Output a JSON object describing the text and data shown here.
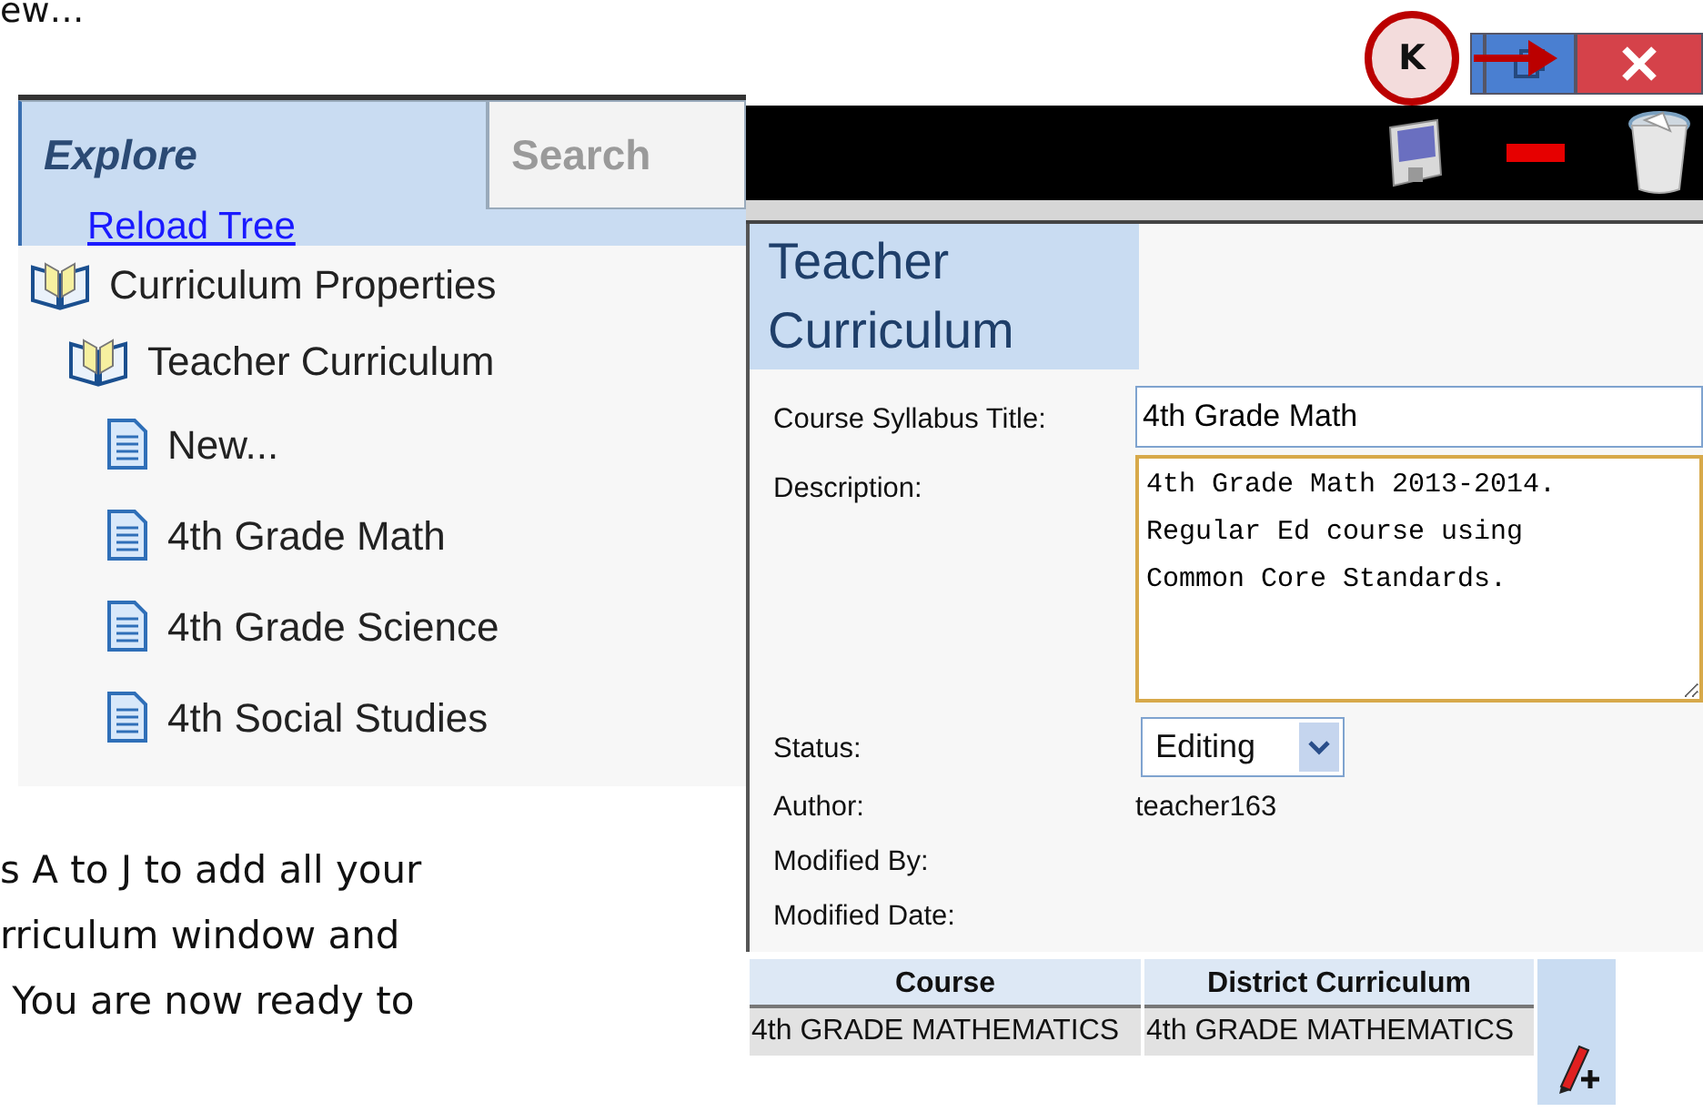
{
  "doc_text_top": "ew…",
  "explorer": {
    "tabs": [
      {
        "label": "Explore",
        "selected": true
      },
      {
        "label": "Search",
        "selected": false
      }
    ],
    "reload_link": "Reload Tree",
    "tree": [
      {
        "label": "Curriculum Properties",
        "kind": "folder",
        "children": [
          {
            "label": "Teacher Curriculum",
            "kind": "folder",
            "children": [
              {
                "label": "New...",
                "kind": "document"
              },
              {
                "label": "4th Grade Math",
                "kind": "document"
              },
              {
                "label": "4th Grade Science",
                "kind": "document"
              },
              {
                "label": "4th Social Studies",
                "kind": "document"
              }
            ]
          }
        ]
      }
    ]
  },
  "doc_paragraph": [
    "s A to J to add all your",
    "rriculum window and",
    " You are now ready to"
  ],
  "callout": {
    "label": "K"
  },
  "form": {
    "title": "Teacher Curriculum",
    "fields": [
      {
        "label": "Course Syllabus Title:",
        "kind": "text",
        "value": "4th Grade Math"
      },
      {
        "label": "Description:",
        "kind": "textarea",
        "value": "4th Grade Math 2013-2014.\nRegular Ed course using\nCommon Core Standards."
      },
      {
        "label": "Status:",
        "kind": "select",
        "value": "Editing"
      },
      {
        "label": "Author:",
        "kind": "static",
        "value": "teacher163"
      },
      {
        "label": "Modified By:",
        "kind": "static"
      },
      {
        "label": "Modified Date:",
        "kind": "static"
      }
    ],
    "table": {
      "columns": [
        "Course",
        "District Curriculum"
      ],
      "rows": [
        [
          "4th GRADE MATHEMATICS",
          "4th GRADE MATHEMATICS"
        ]
      ]
    }
  }
}
